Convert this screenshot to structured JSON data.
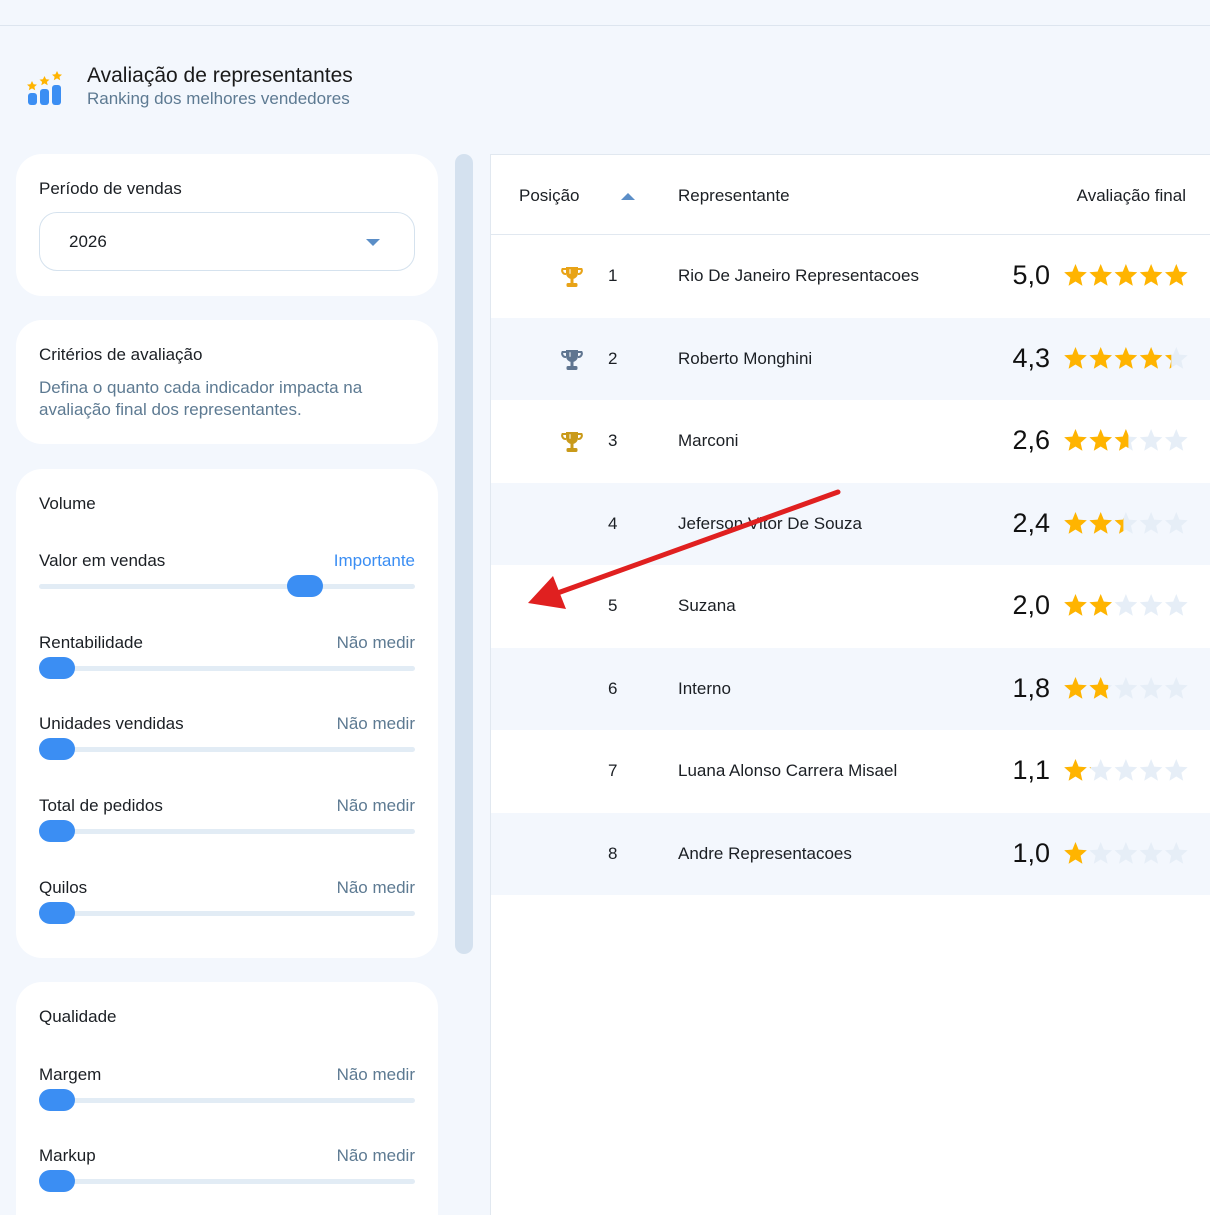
{
  "header": {
    "title": "Avaliação de representantes",
    "subtitle": "Ranking dos melhores vendedores"
  },
  "period": {
    "label": "Período de vendas",
    "value": "2026"
  },
  "criteria": {
    "title": "Critérios de avaliação",
    "description": "Defina o quanto cada indicador impacta na avaliação final dos representantes."
  },
  "volume": {
    "title": "Volume",
    "items": [
      {
        "label": "Valor em vendas",
        "value": "Importante",
        "level": 0.73
      },
      {
        "label": "Rentabilidade",
        "value": "Não medir",
        "level": 0
      },
      {
        "label": "Unidades vendidas",
        "value": "Não medir",
        "level": 0
      },
      {
        "label": "Total de pedidos",
        "value": "Não medir",
        "level": 0
      },
      {
        "label": "Quilos",
        "value": "Não medir",
        "level": 0
      }
    ]
  },
  "quality": {
    "title": "Qualidade",
    "items": [
      {
        "label": "Margem",
        "value": "Não medir",
        "level": 0
      },
      {
        "label": "Markup",
        "value": "Não medir",
        "level": 0
      }
    ]
  },
  "table": {
    "headers": {
      "position": "Posição",
      "representative": "Representante",
      "rating": "Avaliação final"
    },
    "sort": "ascending",
    "rows": [
      {
        "position": "1",
        "name": "Rio De Janeiro Representacoes",
        "score": "5,0",
        "rating": 5.0,
        "trophy": "gold"
      },
      {
        "position": "2",
        "name": "Roberto Monghini",
        "score": "4,3",
        "rating": 4.3,
        "trophy": "silver"
      },
      {
        "position": "3",
        "name": "Marconi",
        "score": "2,6",
        "rating": 2.6,
        "trophy": "bronze"
      },
      {
        "position": "4",
        "name": "Jeferson Vitor De Souza",
        "score": "2,4",
        "rating": 2.4,
        "trophy": ""
      },
      {
        "position": "5",
        "name": "Suzana",
        "score": "2,0",
        "rating": 2.0,
        "trophy": ""
      },
      {
        "position": "6",
        "name": "Interno",
        "score": "1,8",
        "rating": 1.8,
        "trophy": ""
      },
      {
        "position": "7",
        "name": "Luana Alonso Carrera Misael",
        "score": "1,1",
        "rating": 1.1,
        "trophy": ""
      },
      {
        "position": "8",
        "name": "Andre Representacoes",
        "score": "1,0",
        "rating": 1.0,
        "trophy": ""
      }
    ]
  },
  "colors": {
    "accent": "#3b8ef3",
    "star": "#ffb400",
    "star_empty": "#e6eef7",
    "trophy_gold": "#e8a317",
    "trophy_silver": "#5f7590",
    "trophy_bronze": "#c99a1a",
    "annotation_arrow": "#e02020"
  }
}
